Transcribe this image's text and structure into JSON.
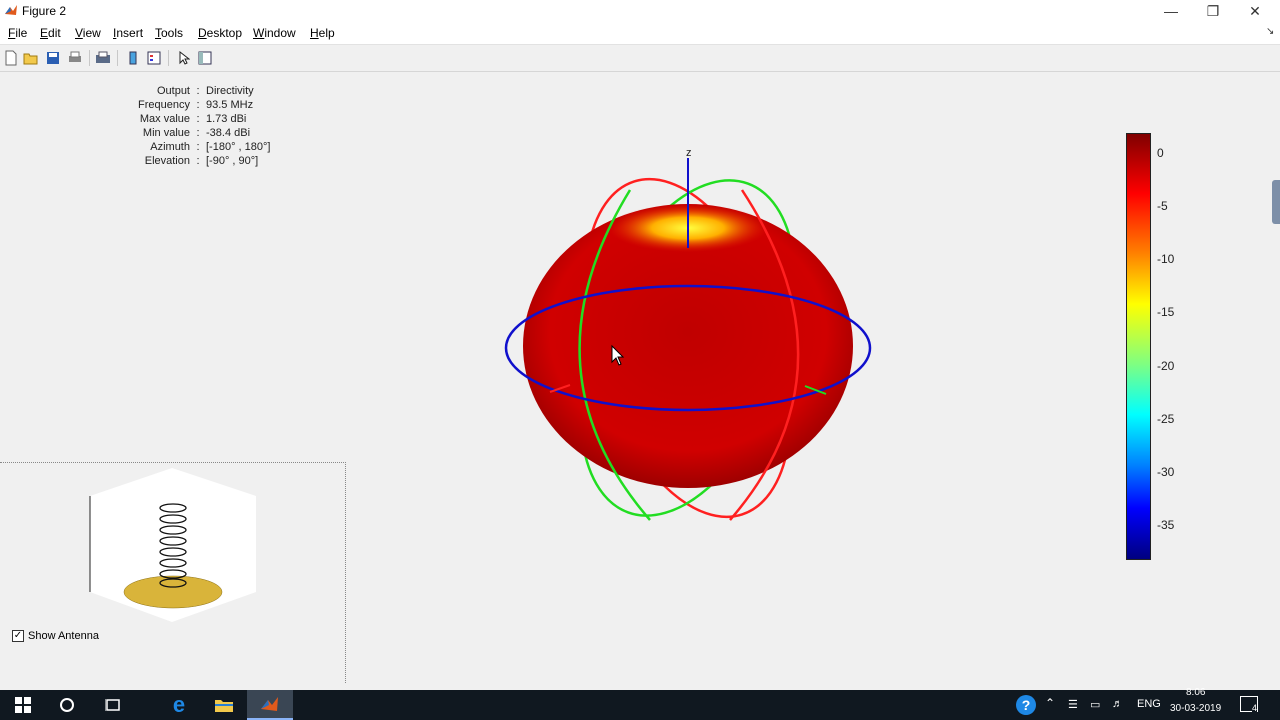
{
  "window": {
    "title": "Figure 2"
  },
  "menu": [
    "File",
    "Edit",
    "View",
    "Insert",
    "Tools",
    "Desktop",
    "Window",
    "Help"
  ],
  "info": [
    {
      "label": "Output",
      "value": "Directivity"
    },
    {
      "label": "Frequency",
      "value": "93.5 MHz"
    },
    {
      "label": "Max value",
      "value": "1.73 dBi"
    },
    {
      "label": "Min value",
      "value": "-38.4 dBi"
    },
    {
      "label": "Azimuth",
      "value": "[-180° , 180°]"
    },
    {
      "label": "Elevation",
      "value": "[-90° , 90°]"
    }
  ],
  "plot": {
    "axis_label": "z"
  },
  "colorbar": {
    "ticks": [
      "0",
      "-5",
      "-10",
      "-15",
      "-20",
      "-25",
      "-30",
      "-35"
    ]
  },
  "antenna": {
    "show_label": "Show Antenna",
    "checked": true
  },
  "taskbar": {
    "lang": "ENG",
    "time": "8:06",
    "date": "30-03-2019",
    "notif": "4"
  },
  "colors": {
    "lobe": "#d40000",
    "ring_x": "#ff2020",
    "ring_y": "#22dd22",
    "ring_z": "#0000cc",
    "disc": "#d9b43a"
  }
}
